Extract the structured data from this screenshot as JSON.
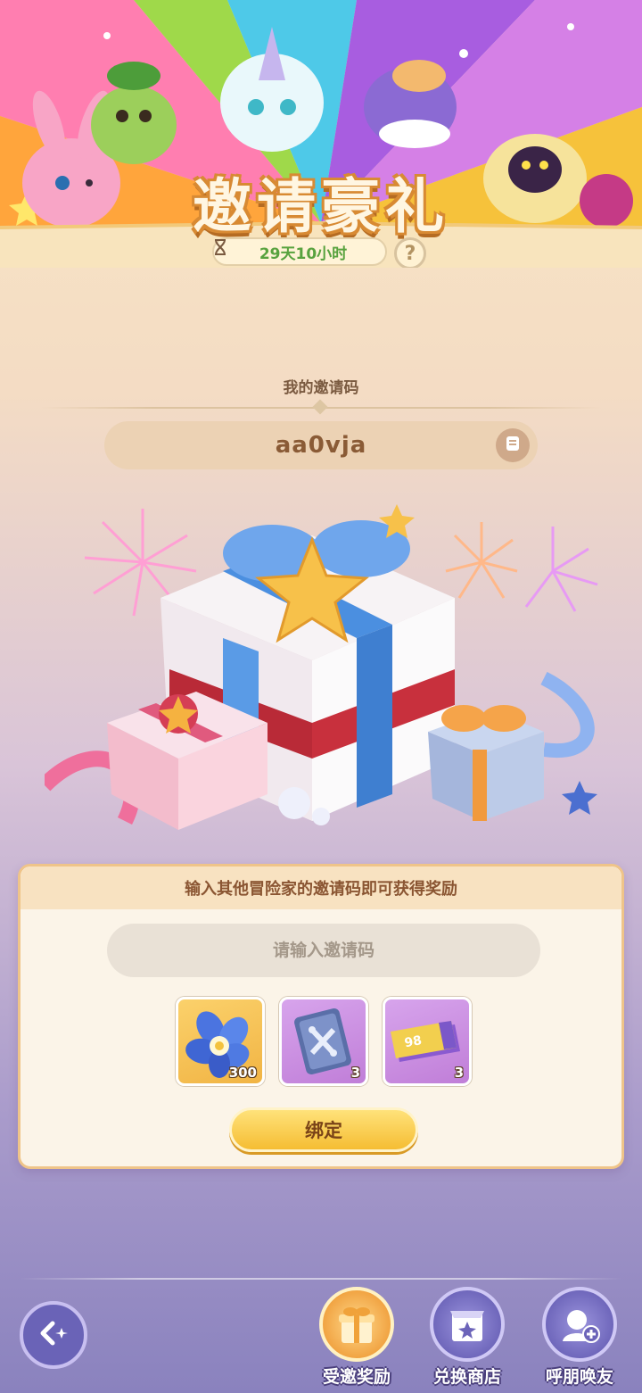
{
  "banner": {
    "title": "邀请豪礼",
    "timer": "29天10小时",
    "help": "?"
  },
  "my_code": {
    "label": "我的邀请码",
    "code": "aa0vja"
  },
  "panel": {
    "heading": "输入其他冒险家的邀请码即可获得奖励",
    "input_value": "",
    "input_placeholder": "请输入邀请码",
    "rewards": [
      {
        "icon": "blue-flower-icon",
        "count": "300"
      },
      {
        "icon": "card-icon",
        "count": "3"
      },
      {
        "icon": "ticket-icon",
        "count": "3",
        "ticket_text": "98"
      }
    ],
    "bind_label": "绑定"
  },
  "nav": {
    "items": [
      {
        "label": "受邀奖励",
        "active": true
      },
      {
        "label": "兑换商店",
        "active": false
      },
      {
        "label": "呼朋唤友",
        "active": false
      }
    ]
  },
  "colors": {
    "accent_gold": "#f5bd33",
    "timer_green": "#58a23e",
    "nav_purple": "#6a63b7"
  }
}
